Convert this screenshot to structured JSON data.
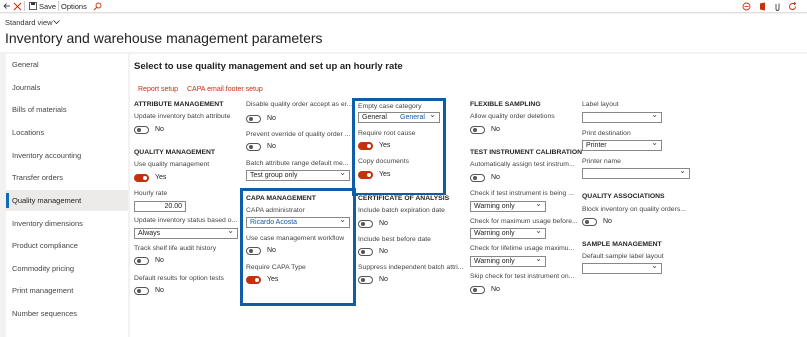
{
  "toolbar": {
    "save": "Save",
    "options": "Options"
  },
  "page": {
    "view": "Standard view",
    "title": "Inventory and warehouse management parameters"
  },
  "nav": [
    "General",
    "Journals",
    "Bills of materials",
    "Locations",
    "Inventory accounting",
    "Transfer orders",
    "Quality management",
    "Inventory dimensions",
    "Product compliance",
    "Commodity pricing",
    "Print management",
    "Number sequences"
  ],
  "content": {
    "heading": "Select to use quality management and set up an hourly rate",
    "links": [
      "Report setup",
      "CAPA email footer setup"
    ],
    "attr": {
      "header": "ATTRIBUTE MANAGEMENT",
      "update_batch": "Update inventory batch attribute",
      "no": "No"
    },
    "qm": {
      "header": "QUALITY MANAGEMENT",
      "use_qm": "Use quality management",
      "yes": "Yes",
      "hourly_rate": "Hourly rate",
      "hourly_value": "20.00",
      "update_status": "Update inventory status based o...",
      "status_value": "Always",
      "track_shelf": "Track shelf life audit history",
      "no": "No",
      "default_results": "Default results for option tests"
    },
    "col2": {
      "disable": "Disable quality order accept as er...",
      "prevent": "Prevent override of quality order ...",
      "no": "No",
      "batch_range": "Batch attribute range default me...",
      "batch_range_value": "Test group only"
    },
    "capa": {
      "header": "CAPA MANAGEMENT",
      "admin": "CAPA administrator",
      "admin_value": "Ricardo Acosta",
      "workflow": "Use case management workflow",
      "require_type": "Require CAPA Type",
      "no": "No",
      "yes": "Yes"
    },
    "case": {
      "empty": "Empty case category",
      "value_left": "General",
      "value_right": "General",
      "require_root": "Require root cause",
      "copy_docs": "Copy documents",
      "yes": "Yes"
    },
    "coa": {
      "header": "CERTIFICATE OF ANALYSIS",
      "incl_exp": "Include batch expiration date",
      "incl_best": "Include best before date",
      "suppress": "Suppress independent batch attri...",
      "no": "No"
    },
    "flex": {
      "header": "FLEXIBLE SAMPLING",
      "allow": "Allow quality order deletions",
      "no": "No"
    },
    "tic": {
      "header": "TEST INSTRUMENT CALIBRATION",
      "auto": "Automatically assign test instrum...",
      "check_if": "Check if test instrument is being ...",
      "check_max": "Check for maximum usage before...",
      "check_life": "Check for lifetime usage maximu...",
      "warn": "Warning only",
      "skip": "Skip check for test instrument on...",
      "no": "No"
    },
    "col5": {
      "label_layout": "Label layout",
      "print_dest": "Print destination",
      "print_value": "Printer",
      "printer_name": "Printer name"
    },
    "qa": {
      "header": "QUALITY ASSOCIATIONS",
      "block": "Block inventory on quality orders...",
      "no": "No"
    },
    "sample": {
      "header": "SAMPLE MANAGEMENT",
      "default_layout": "Default sample label layout"
    }
  }
}
